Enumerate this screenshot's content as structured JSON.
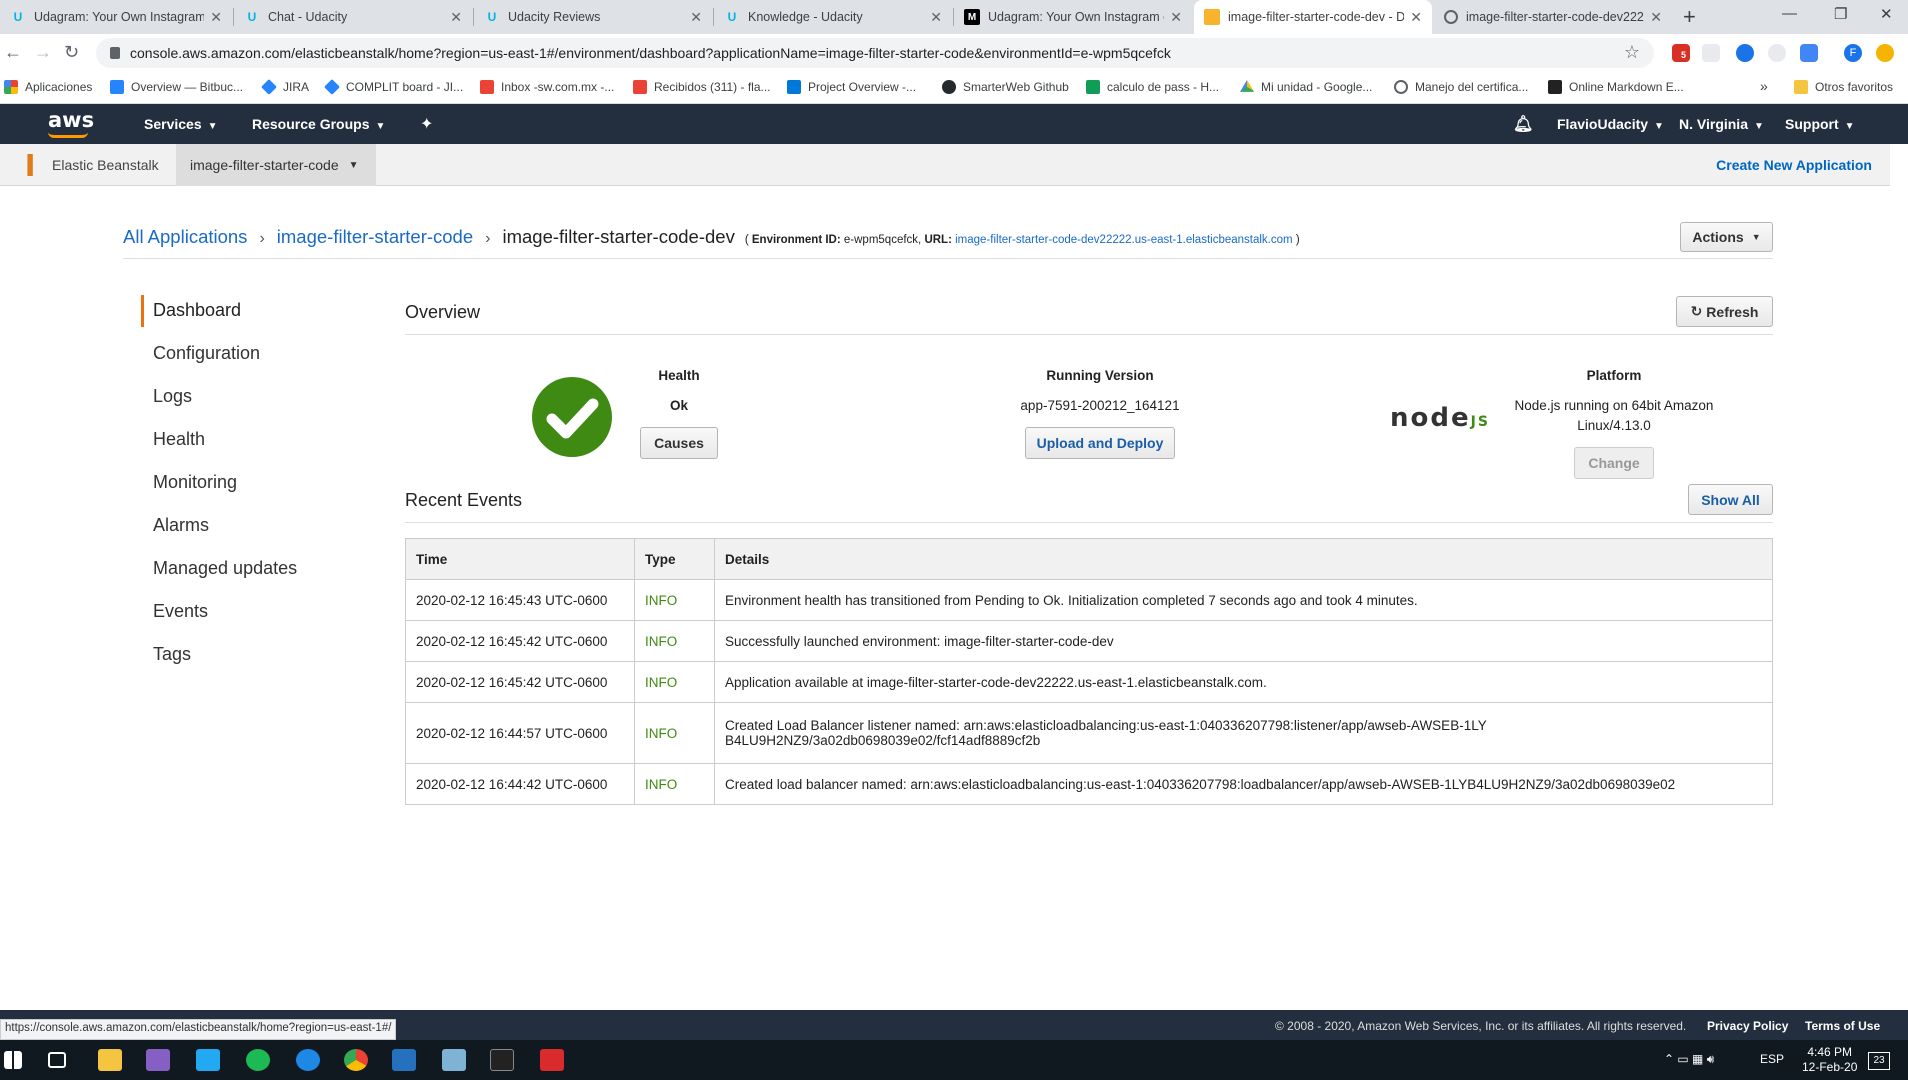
{
  "browser": {
    "tabs": [
      {
        "title": "Udagram: Your Own Instagram o",
        "icon": "udacity-icon"
      },
      {
        "title": "Chat - Udacity",
        "icon": "udacity-icon"
      },
      {
        "title": "Udacity Reviews",
        "icon": "udacity-icon"
      },
      {
        "title": "Knowledge - Udacity",
        "icon": "udacity-icon"
      },
      {
        "title": "Udagram: Your Own Instagram o",
        "icon": "medium-icon"
      },
      {
        "title": "image-filter-starter-code-dev - D",
        "icon": "aws-box-icon"
      },
      {
        "title": "image-filter-starter-code-dev222",
        "icon": "globe-icon"
      }
    ],
    "url": "console.aws.amazon.com/elasticbeanstalk/home?region=us-east-1#/environment/dashboard?applicationName=image-filter-starter-code&environmentId=e-wpm5qcefck",
    "bookmarks": [
      "Aplicaciones",
      "Overview — Bitbuc...",
      "JIRA",
      "COMPLIT board - JI...",
      "Inbox -sw.com.mx -...",
      "Recibidos (311) - fla...",
      "Project Overview -...",
      "SmarterWeb Github",
      "calculo de pass - H...",
      "Mi unidad - Google...",
      "Manejo del certifica...",
      "Online Markdown E..."
    ],
    "other_bookmarks": "Otros favoritos",
    "extension_badge": "5",
    "profile_initial": "F",
    "status_url": "https://console.aws.amazon.com/elasticbeanstalk/home?region=us-east-1#/"
  },
  "aws_nav": {
    "logo": "aws",
    "services": "Services",
    "resource_groups": "Resource Groups",
    "user": "FlavioUdacity",
    "region": "N. Virginia",
    "support": "Support"
  },
  "service_bar": {
    "service": "Elastic Beanstalk",
    "app": "image-filter-starter-code",
    "create_new": "Create New Application"
  },
  "breadcrumb": {
    "all_apps": "All Applications",
    "app": "image-filter-starter-code",
    "env": "image-filter-starter-code-dev",
    "env_id_label": "Environment ID:",
    "env_id": "e-wpm5qcefck,",
    "url_label": "URL:",
    "url": "image-filter-starter-code-dev22222.us-east-1.elasticbeanstalk.com",
    "open_paren": "(",
    "close_paren": ")"
  },
  "actions_label": "Actions",
  "sidebar": {
    "items": [
      "Dashboard",
      "Configuration",
      "Logs",
      "Health",
      "Monitoring",
      "Alarms",
      "Managed updates",
      "Events",
      "Tags"
    ]
  },
  "overview": {
    "title": "Overview",
    "refresh": "Refresh",
    "health_label": "Health",
    "health_value": "Ok",
    "causes": "Causes",
    "running_version_label": "Running Version",
    "running_version": "app-7591-200212_164121",
    "upload_deploy": "Upload and Deploy",
    "platform_label": "Platform",
    "platform_line1": "Node.js running on 64bit Amazon",
    "platform_line2": "Linux/4.13.0",
    "change": "Change",
    "node_logo_text": "node",
    "node_logo_js": "JS"
  },
  "events": {
    "title": "Recent Events",
    "show_all": "Show All",
    "columns": [
      "Time",
      "Type",
      "Details"
    ],
    "rows": [
      {
        "time": "2020-02-12 16:45:43 UTC-0600",
        "type": "INFO",
        "details": "Environment health has transitioned from Pending to Ok. Initialization completed 7 seconds ago and took 4 minutes."
      },
      {
        "time": "2020-02-12 16:45:42 UTC-0600",
        "type": "INFO",
        "details": "Successfully launched environment: image-filter-starter-code-dev"
      },
      {
        "time": "2020-02-12 16:45:42 UTC-0600",
        "type": "INFO",
        "details": "Application available at image-filter-starter-code-dev22222.us-east-1.elasticbeanstalk.com."
      },
      {
        "time": "2020-02-12 16:44:57 UTC-0600",
        "type": "INFO",
        "details": "Created Load Balancer listener named: arn:aws:elasticloadbalancing:us-east-1:040336207798:listener/app/awseb-AWSEB-1LYB4LU9H2NZ9/3a02db0698039e02/fcf14adf8889cf2b"
      },
      {
        "time": "2020-02-12 16:44:42 UTC-0600",
        "type": "INFO",
        "details": "Created load balancer named: arn:aws:elasticloadbalancing:us-east-1:040336207798:loadbalancer/app/awseb-AWSEB-1LYB4LU9H2NZ9/3a02db0698039e02"
      }
    ]
  },
  "footer": {
    "copyright": "© 2008 - 2020, Amazon Web Services, Inc. or its affiliates. All rights reserved.",
    "privacy": "Privacy Policy",
    "terms": "Terms of Use"
  },
  "taskbar": {
    "lang": "ESP",
    "time": "4:46 PM",
    "date": "12-Feb-20",
    "notifications": "23"
  },
  "colors": {
    "aws_nav": "#232f3e",
    "aws_orange": "#ff9900",
    "link_blue": "#1a6ac6",
    "ok_green": "#3e8a13"
  }
}
